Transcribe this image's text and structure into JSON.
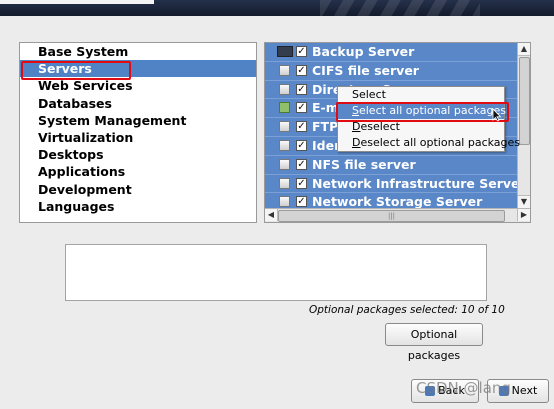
{
  "groups": {
    "items": [
      "Base System",
      "Servers",
      "Web Services",
      "Databases",
      "System Management",
      "Virtualization",
      "Desktops",
      "Applications",
      "Development",
      "Languages"
    ],
    "selected": "Servers"
  },
  "packages": {
    "rows": [
      {
        "label": "Backup Server",
        "checked": true
      },
      {
        "label": "CIFS file server",
        "checked": true
      },
      {
        "label": "Directory Server",
        "checked": true
      },
      {
        "label": "E-m",
        "checked": true
      },
      {
        "label": "FTP",
        "checked": true
      },
      {
        "label": "Iden",
        "checked": true
      },
      {
        "label": "NFS file server",
        "checked": true
      },
      {
        "label": "Network Infrastructure Server",
        "checked": true
      },
      {
        "label": "Network Storage Server",
        "checked": true
      }
    ],
    "check_glyph": "☑"
  },
  "context_menu": {
    "items": [
      {
        "accel": "",
        "label": "Select",
        "rest": ""
      },
      {
        "accel": "S",
        "label": "",
        "rest": "elect all optional packages"
      },
      {
        "accel": "D",
        "label": "",
        "rest": "eselect"
      },
      {
        "accel": "D",
        "label": "",
        "rest": "eselect all optional packages"
      }
    ],
    "select": "Select",
    "select_all_accel": "S",
    "select_all_rest": "elect all optional packages",
    "deselect_accel": "D",
    "deselect_rest": "eselect",
    "deselect_all_accel": "D",
    "deselect_all_rest": "eselect all optional packages"
  },
  "status": {
    "optional_selected": "Optional packages selected: 10 of 10"
  },
  "buttons": {
    "optional_packages": "Optional packages",
    "back": "Back",
    "next": "Next"
  },
  "watermark": "CSDN @lang",
  "colors": {
    "selection_blue": "#4f83c6",
    "list_blue": "#5987c8",
    "highlight_red": "#e10b14",
    "banner_navy": "#1d2638"
  },
  "icons": {
    "package": "package-icon",
    "checkbox": "checkbox-checked-icon",
    "cursor": "mouse-cursor-icon",
    "back": "back-arrow-icon",
    "next": "next-arrow-icon"
  }
}
